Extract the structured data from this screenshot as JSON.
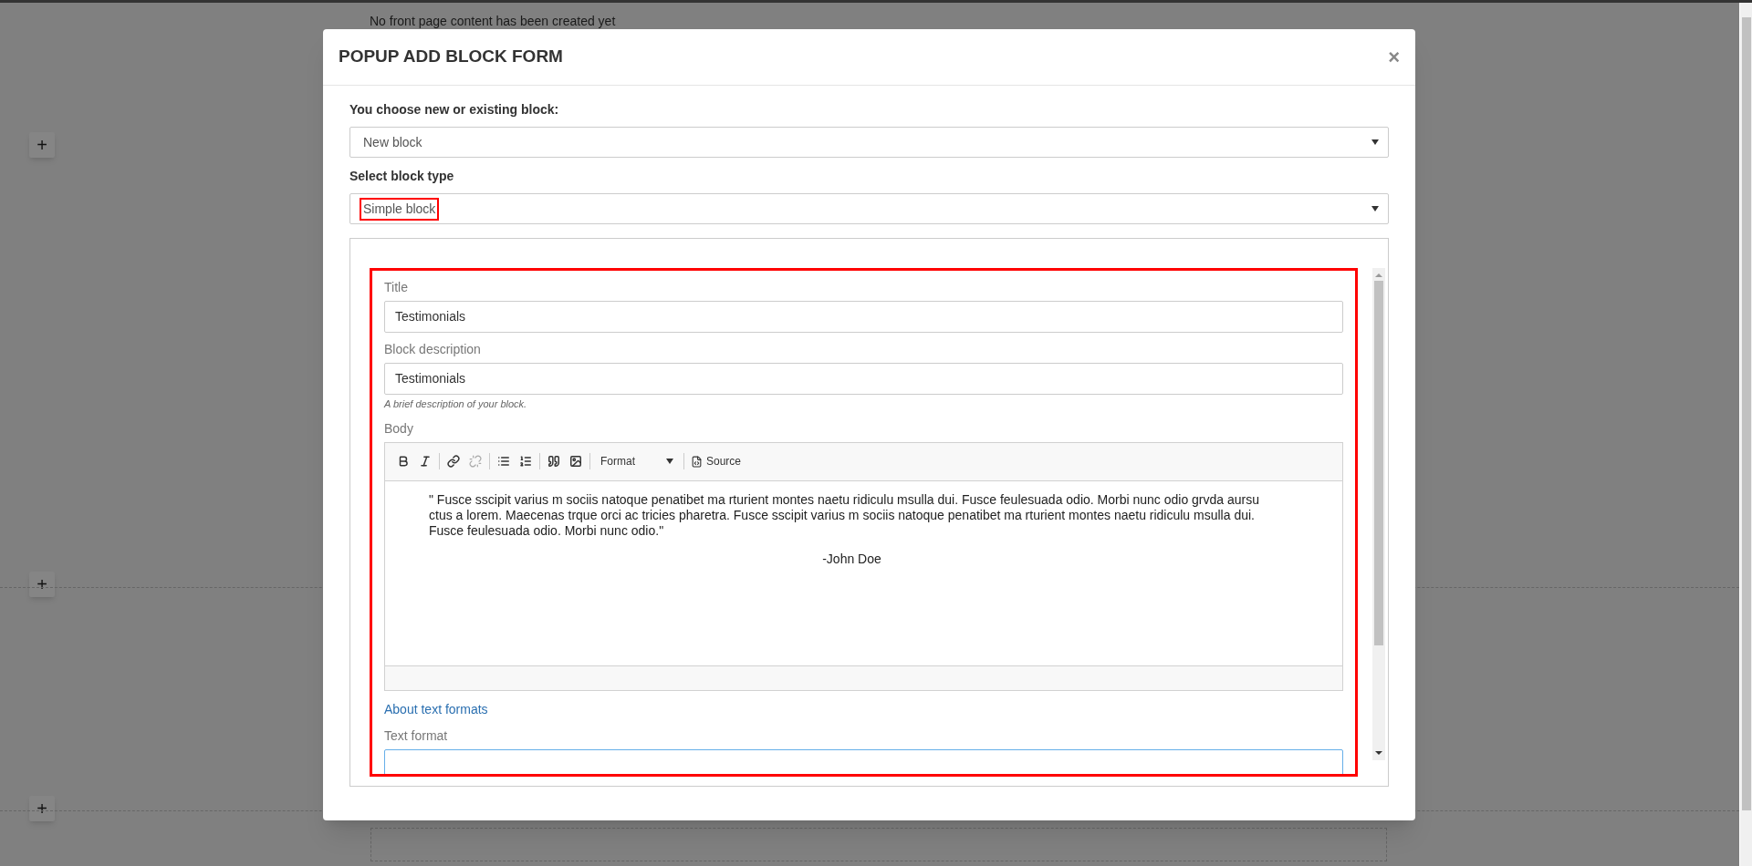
{
  "page": {
    "empty_message": "No front page content has been created yet",
    "add_buttons": [
      "+",
      "+",
      "+"
    ]
  },
  "dialog": {
    "title": "POPUP ADD BLOCK FORM",
    "close": "×",
    "selects": [
      {
        "label": "You choose new or existing block:",
        "value": "New block",
        "highlighted": false
      },
      {
        "label": "Select block type",
        "value": "Simple block",
        "highlighted": true
      }
    ],
    "form": {
      "highlighted": true,
      "fields": [
        {
          "label": "Title",
          "value": "Testimonials"
        },
        {
          "label": "Block description",
          "value": "Testimonials",
          "hint": "A brief description of your block."
        }
      ],
      "body": {
        "label": "Body",
        "format": "Format",
        "source": "Source",
        "paragraphs": [
          {
            "kind": "quote",
            "text": "\" Fusce sscipit varius m sociis natoque penatibet ma rturient montes naetu ridiculu msulla dui. Fusce feulesuada odio. Morbi nunc odio grvda aursu ctus a lorem. Maecenas trque orci ac tricies pharetra. Fusce sscipit varius m sociis natoque penatibet ma rturient montes naetu ridiculu msulla dui. Fusce feulesuada odio. Morbi nunc odio.\""
          },
          {
            "kind": "signature",
            "text": "-John Doe"
          }
        ]
      },
      "about_link": "About text formats",
      "text_format_label": "Text format"
    }
  }
}
